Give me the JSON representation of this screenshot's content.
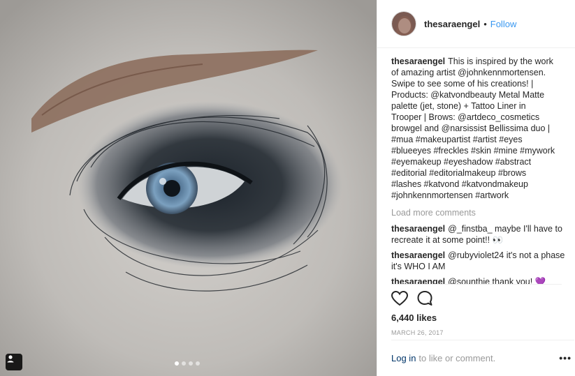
{
  "post": {
    "username": "thesaraengel",
    "separator": "•",
    "follow_label": "Follow",
    "caption_user": "thesaraengel",
    "caption_lines": [
      "This is inspired by the work",
      "of amazing artist @johnkennmortensen.",
      "Swipe to see some of his creations! |",
      "Products: @katvondbeauty Metal Matte",
      "palette (jet, stone) + Tattoo Liner in",
      "Trooper | Brows: @artdeco_cosmetics",
      "browgel and @narsissist Bellissima duo |",
      "#mua #makeupartist #artist #eyes",
      "#blueeyes #freckles #skin #mine #mywork",
      "#eyemakeup #eyeshadow #abstract",
      "#editorial #editorialmakeup #brows",
      "#lashes #katvond #katvondmakeup",
      "#johnkennmortensen #artwork"
    ],
    "load_more": "Load more comments",
    "comments": [
      {
        "user": "thesaraengel",
        "text": "@_finstba_ maybe I'll have to recreate it at some point!! 👀"
      },
      {
        "user": "thesaraengel",
        "text": "@rubyviolet24 it's not a phase it's WHO I AM"
      },
      {
        "user": "thesaraengel",
        "text": "@sounthie thank you! 💜"
      }
    ],
    "likes": "6,440 likes",
    "date": "MARCH 26, 2017",
    "login_label": "Log in",
    "login_rest": "to like or comment.",
    "more_label": "•••"
  },
  "icons": {
    "heart": "heart-icon",
    "comment": "comment-icon",
    "tag": "user-tag-icon"
  },
  "colors": {
    "link_blue": "#3897f0",
    "login_blue": "#003569",
    "muted": "#999999"
  },
  "carousel": {
    "count": 4,
    "active": 1
  }
}
